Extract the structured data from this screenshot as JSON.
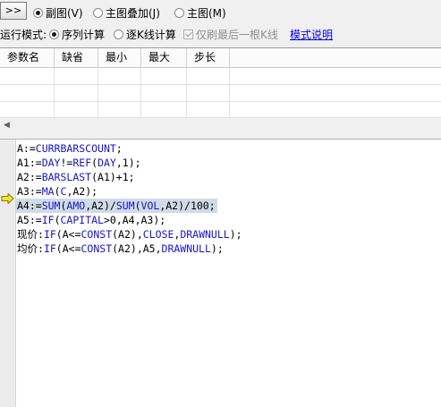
{
  "toolbar": {
    "expand_label": ">>",
    "radios": [
      {
        "label": "副图(V)",
        "checked": true
      },
      {
        "label": "主图叠加(J)",
        "checked": false
      },
      {
        "label": "主图(M)",
        "checked": false
      }
    ]
  },
  "run_mode": {
    "label": "运行模式:",
    "options": [
      {
        "label": "序列计算",
        "checked": true
      },
      {
        "label": "逐K线计算",
        "checked": false
      }
    ],
    "refresh_last_only": {
      "label": "仅刷最后一根K线",
      "checked": true,
      "disabled": true
    },
    "help_link": "模式说明"
  },
  "param_table": {
    "headers": [
      "参数名",
      "缺省",
      "最小",
      "最大",
      "步长"
    ],
    "rows": [
      [
        "",
        "",
        "",
        "",
        ""
      ],
      [
        "",
        "",
        "",
        "",
        ""
      ],
      [
        "",
        "",
        "",
        "",
        ""
      ]
    ]
  },
  "editor": {
    "current_line_index": 4,
    "lines": [
      {
        "tokens": [
          [
            "A:=",
            "p"
          ],
          [
            "CURRBARSCOUNT",
            "k"
          ],
          [
            ";",
            "p"
          ]
        ]
      },
      {
        "tokens": [
          [
            "A1:=",
            "p"
          ],
          [
            "DAY",
            "k"
          ],
          [
            "!=",
            "p"
          ],
          [
            "REF",
            "k"
          ],
          [
            "(",
            "p"
          ],
          [
            "DAY",
            "k"
          ],
          [
            ",1);",
            "p"
          ]
        ]
      },
      {
        "tokens": [
          [
            "A2:=",
            "p"
          ],
          [
            "BARSLAST",
            "k"
          ],
          [
            "(A1)+1;",
            "p"
          ]
        ]
      },
      {
        "tokens": [
          [
            "A3:=",
            "p"
          ],
          [
            "MA",
            "k"
          ],
          [
            "(",
            "p"
          ],
          [
            "C",
            "k"
          ],
          [
            ",A2);",
            "p"
          ]
        ]
      },
      {
        "tokens": [
          [
            "A4:=",
            "p"
          ],
          [
            "SUM",
            "k"
          ],
          [
            "(",
            "p"
          ],
          [
            "AMO",
            "k"
          ],
          [
            ",A2)/",
            "p"
          ],
          [
            "SUM",
            "k"
          ],
          [
            "(",
            "p"
          ],
          [
            "VOL",
            "k"
          ],
          [
            ",A2)/100;",
            "p"
          ]
        ]
      },
      {
        "tokens": [
          [
            "A5:=",
            "p"
          ],
          [
            "IF",
            "k"
          ],
          [
            "(",
            "p"
          ],
          [
            "CAPITAL",
            "k"
          ],
          [
            ">0,A4,A3);",
            "p"
          ]
        ]
      },
      {
        "tokens": [
          [
            "现价:",
            "p"
          ],
          [
            "IF",
            "k"
          ],
          [
            "(A<=",
            "p"
          ],
          [
            "CONST",
            "k"
          ],
          [
            "(A2),",
            "p"
          ],
          [
            "CLOSE",
            "k"
          ],
          [
            ",",
            "p"
          ],
          [
            "DRAWNULL",
            "k"
          ],
          [
            ");",
            "p"
          ]
        ]
      },
      {
        "tokens": [
          [
            "均价:",
            "p"
          ],
          [
            "IF",
            "k"
          ],
          [
            "(A<=",
            "p"
          ],
          [
            "CONST",
            "k"
          ],
          [
            "(A2),A5,",
            "p"
          ],
          [
            "DRAWNULL",
            "k"
          ],
          [
            ");",
            "p"
          ]
        ]
      }
    ]
  },
  "colors": {
    "keyword": "#1515c8",
    "current_line_bg": "#cfdbe6",
    "arrow_fill": "#f6e51d",
    "link": "#0000ee"
  }
}
